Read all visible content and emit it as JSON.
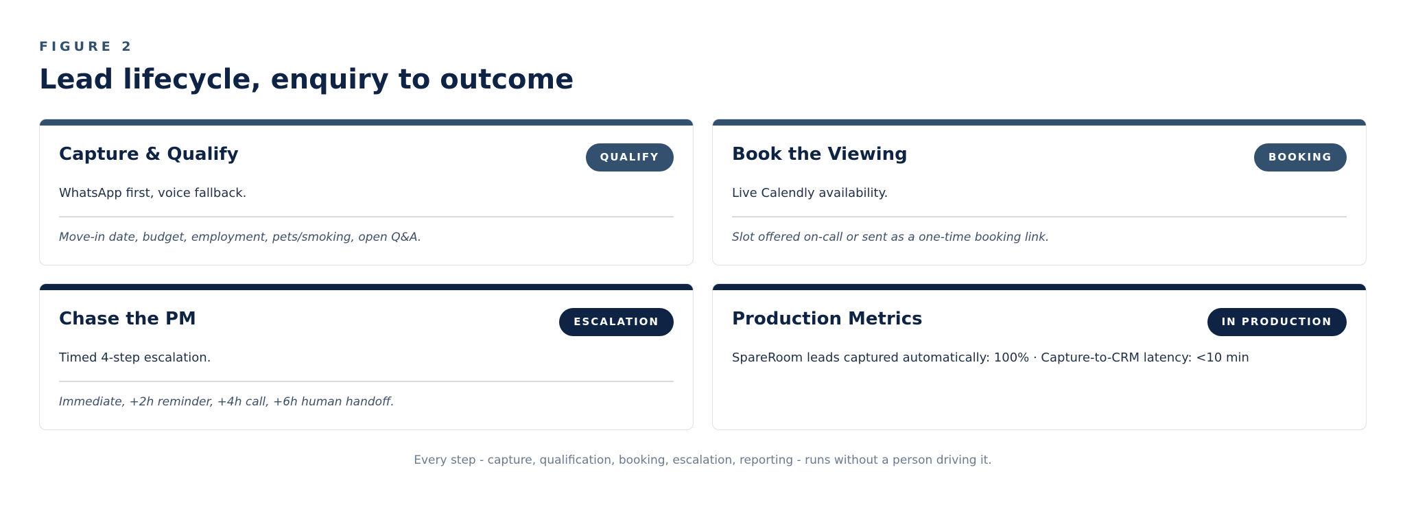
{
  "figure": {
    "eyebrow": "FIGURE 2",
    "title": "Lead lifecycle, enquiry to outcome"
  },
  "colors": {
    "slate": "#33506f",
    "navy": "#0f2444"
  },
  "cards": [
    {
      "title": "Capture & Qualify",
      "badge": "QUALIFY",
      "description": "WhatsApp first, voice fallback.",
      "note": "Move-in date, budget, employment, pets/smoking, open Q&A.",
      "accent": "#33506f"
    },
    {
      "title": "Book the Viewing",
      "badge": "BOOKING",
      "description": "Live Calendly availability.",
      "note": "Slot offered on-call or sent as a one-time booking link.",
      "accent": "#33506f"
    },
    {
      "title": "Chase the PM",
      "badge": "ESCALATION",
      "description": "Timed 4-step escalation.",
      "note": "Immediate, +2h reminder, +4h call, +6h human handoff.",
      "accent": "#0f2444"
    },
    {
      "title": "Production Metrics",
      "badge": "IN PRODUCTION",
      "description": "SpareRoom leads captured automatically: 100% · Capture-to-CRM latency: <10 min",
      "note": "",
      "accent": "#0f2444"
    }
  ],
  "caption": "Every step - capture, qualification, booking, escalation, reporting - runs without a person driving it."
}
